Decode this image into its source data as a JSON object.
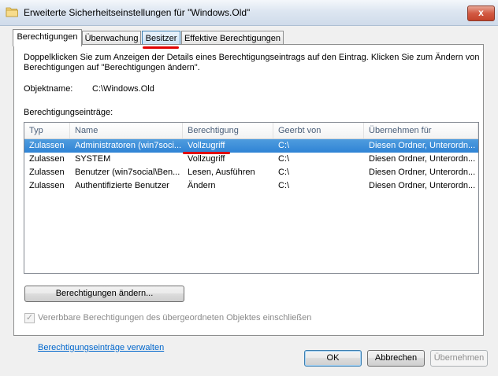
{
  "window": {
    "title": "Erweiterte Sicherheitseinstellungen für \"Windows.Old\"",
    "close_glyph": "x"
  },
  "tabs": [
    {
      "label": "Berechtigungen"
    },
    {
      "label": "Überwachung"
    },
    {
      "label": "Besitzer"
    },
    {
      "label": "Effektive Berechtigungen"
    }
  ],
  "panel": {
    "description": "Doppelklicken Sie zum Anzeigen der Details eines Berechtigungseintrags auf den Eintrag. Klicken Sie zum Ändern von Berechtigungen auf \"Berechtigungen ändern\".",
    "object_label": "Objektname:",
    "object_value": "C:\\Windows.Old",
    "entries_label": "Berechtigungseinträge:"
  },
  "table": {
    "columns": [
      "Typ",
      "Name",
      "Berechtigung",
      "Geerbt von",
      "Übernehmen für"
    ],
    "rows": [
      [
        "Zulassen",
        "Administratoren (win7soci...",
        "Vollzugriff",
        "C:\\",
        "Diesen Ordner, Unterordn..."
      ],
      [
        "Zulassen",
        "SYSTEM",
        "Vollzugriff",
        "C:\\",
        "Diesen Ordner, Unterordn..."
      ],
      [
        "Zulassen",
        "Benutzer (win7social\\Ben...",
        "Lesen, Ausführen",
        "C:\\",
        "Diesen Ordner, Unterordn..."
      ],
      [
        "Zulassen",
        "Authentifizierte Benutzer",
        "Ändern",
        "C:\\",
        "Diesen Ordner, Unterordn..."
      ]
    ]
  },
  "buttons": {
    "change_permissions": "Berechtigungen ändern...",
    "ok": "OK",
    "cancel": "Abbrechen",
    "apply": "Übernehmen"
  },
  "inherit_checkbox": {
    "label": "Vererbbare Berechtigungen des übergeordneten Objektes einschließen",
    "checked": true
  },
  "manage_link": "Berechtigungseinträge verwalten",
  "colors": {
    "accent": "#3c7fb1",
    "selection": "#3a8bd8",
    "annotation": "#e10000",
    "link": "#0066cc"
  }
}
